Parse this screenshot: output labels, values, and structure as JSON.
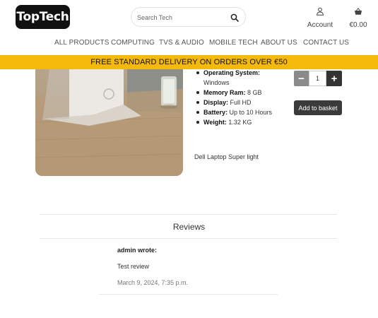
{
  "header": {
    "logo": "TopTech",
    "search_placeholder": "Search Tech",
    "account_label": "Account",
    "basket_total": "€0.00"
  },
  "nav": {
    "items": [
      "ALL PRODUCTS",
      "COMPUTING",
      "TVS & AUDIO",
      "MOBILE TECH",
      "ABOUT US",
      "CONTACT US"
    ]
  },
  "banner": {
    "text": "FREE STANDARD DELIVERY ON ORDERS OVER €50"
  },
  "product": {
    "specs": [
      {
        "label": "Operating System:",
        "value": "Windows"
      },
      {
        "label": "Memory Ram:",
        "value": "8 GB"
      },
      {
        "label": "Display:",
        "value": "Full HD"
      },
      {
        "label": "Battery:",
        "value": "Up to 10 Hours"
      },
      {
        "label": "Weight:",
        "value": "1.32 KG"
      }
    ],
    "short_description": "Dell Laptop Super light",
    "quantity": "1",
    "minus_label": "−",
    "plus_label": "+",
    "add_to_basket": "Add to basket"
  },
  "reviews": {
    "title": "Reviews",
    "items": [
      {
        "author": "admin wrote:",
        "text": "Test review",
        "date": "March 9, 2024, 7:35 p.m."
      }
    ]
  },
  "colors": {
    "banner": "#f5b90b",
    "logo_bg": "#111111",
    "button_dark": "#3b3b3b"
  }
}
